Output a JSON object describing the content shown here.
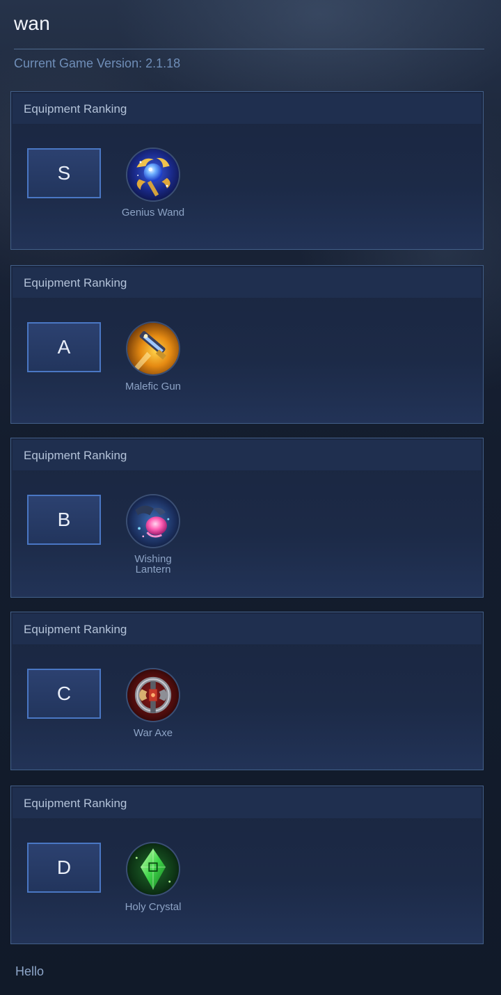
{
  "header": {
    "title": "wan",
    "version_text": "Current Game Version: 2.1.18"
  },
  "panels": [
    {
      "heading": "Equipment Ranking",
      "tier": "S",
      "item": {
        "name": "Genius Wand",
        "icon": "genius-wand-icon"
      }
    },
    {
      "heading": "Equipment Ranking",
      "tier": "A",
      "item": {
        "name": "Malefic Gun",
        "icon": "malefic-gun-icon"
      }
    },
    {
      "heading": "Equipment Ranking",
      "tier": "B",
      "item": {
        "name": "Wishing Lantern",
        "icon": "wishing-lantern-icon"
      }
    },
    {
      "heading": "Equipment Ranking",
      "tier": "C",
      "item": {
        "name": "War Axe",
        "icon": "war-axe-icon"
      }
    },
    {
      "heading": "Equipment Ranking",
      "tier": "D",
      "item": {
        "name": "Holy Crystal",
        "icon": "holy-crystal-icon"
      }
    }
  ],
  "footer": {
    "text": "Hello"
  },
  "colors": {
    "accent": "#4a77c4",
    "panel_border": "#43608a",
    "version_text": "#6f8eb8"
  }
}
